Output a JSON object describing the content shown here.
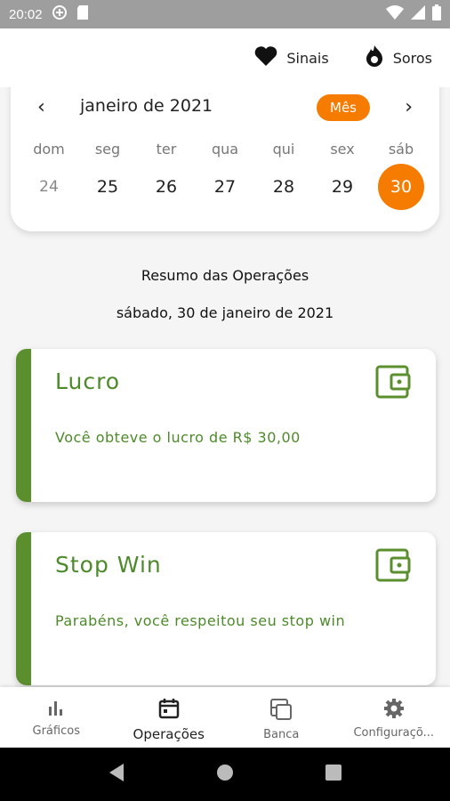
{
  "status_bar": {
    "time": "20:02"
  },
  "app_bar": {
    "actions": [
      {
        "label": "Sinais",
        "icon": "heart-icon"
      },
      {
        "label": "Soros",
        "icon": "fire-icon"
      }
    ]
  },
  "calendar": {
    "month_label": "janeiro de 2021",
    "mode_label": "Mês",
    "weekdays": [
      "dom",
      "seg",
      "ter",
      "qua",
      "qui",
      "sex",
      "sáb"
    ],
    "days": [
      "24",
      "25",
      "26",
      "27",
      "28",
      "29",
      "30"
    ],
    "selected_day": "30"
  },
  "summary": {
    "title": "Resumo das Operações",
    "date": "sábado, 30 de janeiro de 2021"
  },
  "cards": [
    {
      "title": "Lucro",
      "text": "Você obteve o lucro de R$ 30,00",
      "icon": "wallet-icon"
    },
    {
      "title": "Stop Win",
      "text": "Parabéns, você respeitou seu stop win",
      "icon": "wallet-icon"
    }
  ],
  "bottom_nav": {
    "items": [
      {
        "label": "Gráficos",
        "icon": "bar-chart-icon"
      },
      {
        "label": "Operações",
        "icon": "calendar-icon"
      },
      {
        "label": "Banca",
        "icon": "banca-icon"
      },
      {
        "label": "Configuraçõ...",
        "icon": "gear-icon"
      }
    ],
    "active_index": 1
  },
  "colors": {
    "accent_orange": "#f57c00",
    "green": "#5b8f2e",
    "status_bar": "#9e9e9e"
  }
}
